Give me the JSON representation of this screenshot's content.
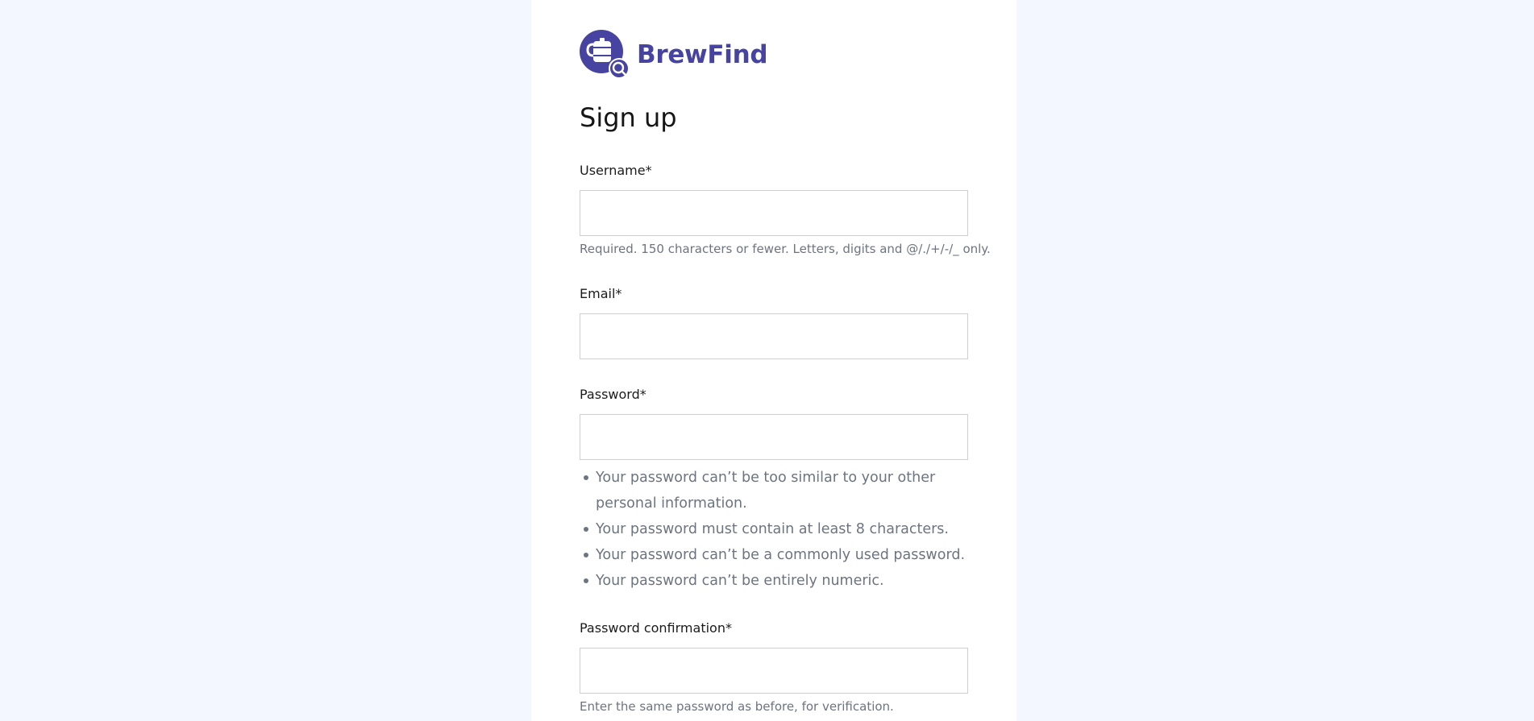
{
  "brand": {
    "name": "BrewFind",
    "logo_icon": "beer-keg-search-icon",
    "color": "#4743a1"
  },
  "page": {
    "title": "Sign up"
  },
  "form": {
    "username": {
      "label": "Username*",
      "value": "",
      "placeholder": "",
      "help": "Required. 150 characters or fewer. Letters, digits and @/./+/-/_ only."
    },
    "email": {
      "label": "Email*",
      "value": "",
      "placeholder": ""
    },
    "password": {
      "label": "Password*",
      "value": "",
      "placeholder": "",
      "rules": [
        "Your password can’t be too similar to your other personal information.",
        "Your password must contain at least 8 characters.",
        "Your password can’t be a commonly used password.",
        "Your password can’t be entirely numeric."
      ]
    },
    "password_confirmation": {
      "label": "Password confirmation*",
      "value": "",
      "placeholder": "",
      "help": "Enter the same password as before, for verification."
    }
  }
}
